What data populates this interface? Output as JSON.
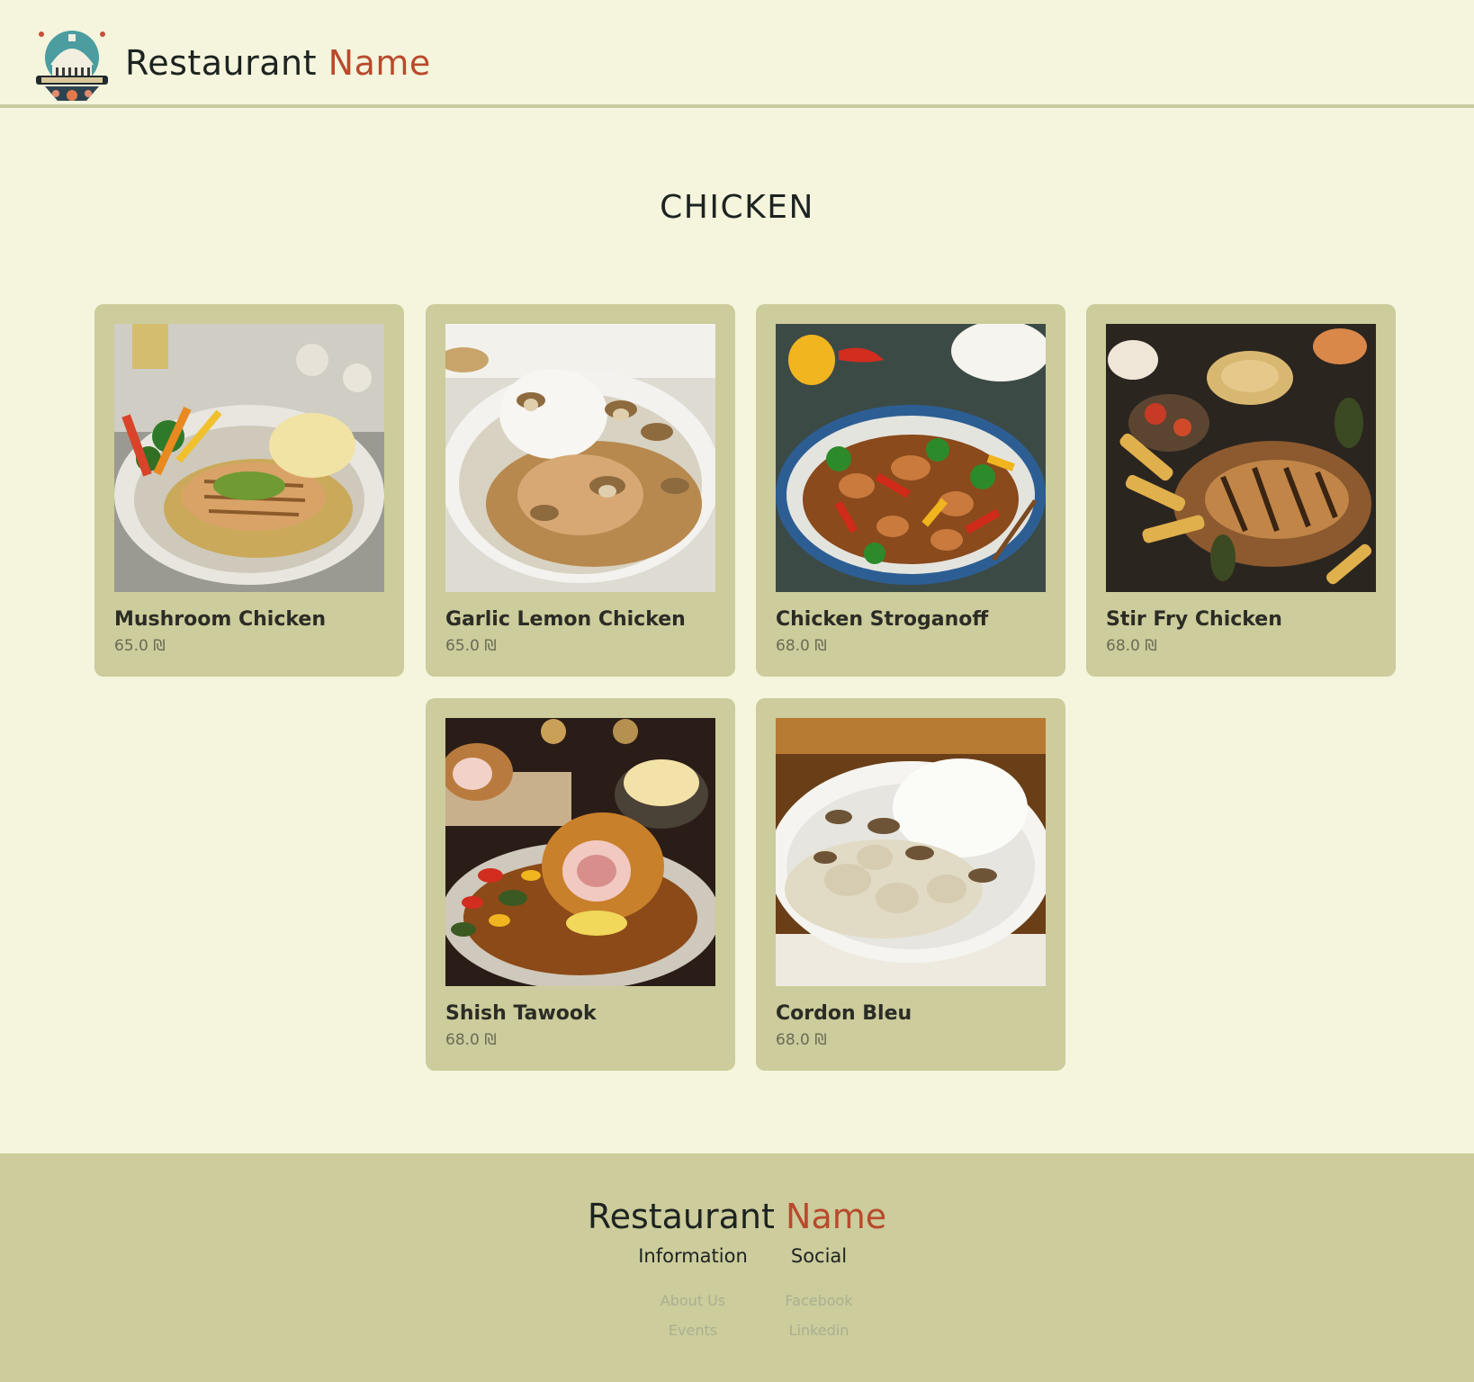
{
  "header": {
    "brand_primary": "Restaurant",
    "brand_accent": "Name",
    "logo_icon": "restaurant-dome-logo"
  },
  "section": {
    "title": "CHICKEN"
  },
  "menu_items": [
    {
      "name": "Mushroom Chicken",
      "price": "65.0 ₪",
      "image": "grilled-chicken-with-vegetables-and-mashed-potato"
    },
    {
      "name": "Garlic Lemon Chicken",
      "price": "65.0 ₪",
      "image": "chicken-with-mushroom-sauce-and-rice"
    },
    {
      "name": "Chicken Stroganoff",
      "price": "68.0 ₪",
      "image": "chicken-stir-fry-with-peppers"
    },
    {
      "name": "Stir Fry Chicken",
      "price": "68.0 ₪",
      "image": "grilled-chicken-platter-with-potatoes"
    },
    {
      "name": "Shish Tawook",
      "price": "68.0 ₪",
      "image": "stuffed-breaded-chicken-roll"
    },
    {
      "name": "Cordon Bleu",
      "price": "68.0 ₪",
      "image": "creamy-chicken-mushrooms-with-rice"
    }
  ],
  "footer": {
    "brand_primary": "Restaurant",
    "brand_accent": "Name",
    "information": {
      "heading": "Information",
      "links": [
        "About Us",
        "Events"
      ]
    },
    "social": {
      "heading": "Social",
      "links": [
        "Facebook",
        "Linkedin"
      ]
    }
  },
  "colors": {
    "page_background": "#f4f5dc",
    "card_background": "#cccc9c",
    "accent": "#b94a2c",
    "text": "#1d2320"
  }
}
